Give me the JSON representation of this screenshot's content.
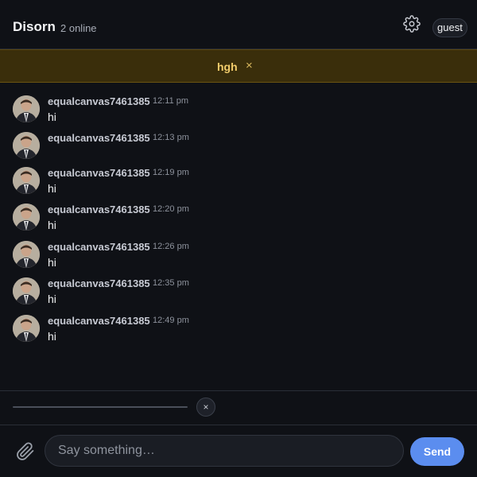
{
  "header": {
    "title": "Disorn",
    "online": "2 online",
    "user": "guest"
  },
  "banner": {
    "text": "hgh",
    "close": "×"
  },
  "messages": [
    {
      "user": "equalcanvas7461385",
      "time": "12:11 pm",
      "text": "hi"
    },
    {
      "user": "equalcanvas7461385",
      "time": "12:13 pm",
      "text": ""
    },
    {
      "user": "equalcanvas7461385",
      "time": "12:19 pm",
      "text": "hi"
    },
    {
      "user": "equalcanvas7461385",
      "time": "12:20 pm",
      "text": "hi"
    },
    {
      "user": "equalcanvas7461385",
      "time": "12:26 pm",
      "text": "hi"
    },
    {
      "user": "equalcanvas7461385",
      "time": "12:35 pm",
      "text": "hi"
    },
    {
      "user": "equalcanvas7461385",
      "time": "12:49 pm",
      "text": "hi"
    }
  ],
  "upload": {
    "cancel": "×"
  },
  "composer": {
    "placeholder": "Say something…",
    "send": "Send"
  },
  "colors": {
    "background": "#0f1116",
    "banner": "#3a2e0b",
    "banner_text": "#f2cc6b",
    "accent": "#5b8def"
  },
  "icons": {
    "settings": "gear-icon",
    "attach": "paperclip-icon",
    "avatar": "user-avatar"
  }
}
